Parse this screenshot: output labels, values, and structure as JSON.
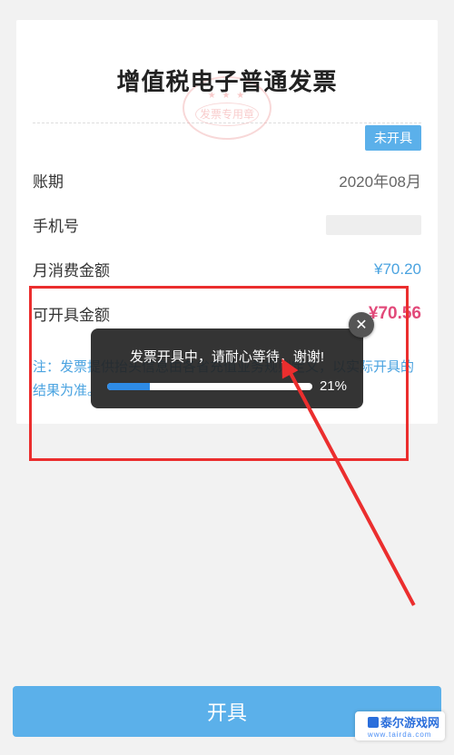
{
  "title": "增值税电子普通发票",
  "stamp": {
    "stars": "★ ★ ★",
    "text": "发票专用章"
  },
  "badge": "未开具",
  "rows": {
    "period_label": "账期",
    "period_value": "2020年08月",
    "phone_label": "手机号",
    "month_label": "月消费金额",
    "month_value": "¥70.20",
    "avail_label": "可开具金额",
    "avail_value": "¥70.56"
  },
  "note": "注：发票提供抬头信息由各省充值业务规则定义，以实际开具的结果为准。",
  "toast": {
    "message": "发票开具中，请耐心等待，谢谢!",
    "percent_text": "21%",
    "percent_value": 21
  },
  "submit": "开具",
  "watermark": {
    "main": "泰尔游戏网",
    "sub": "www.tairda.com"
  }
}
